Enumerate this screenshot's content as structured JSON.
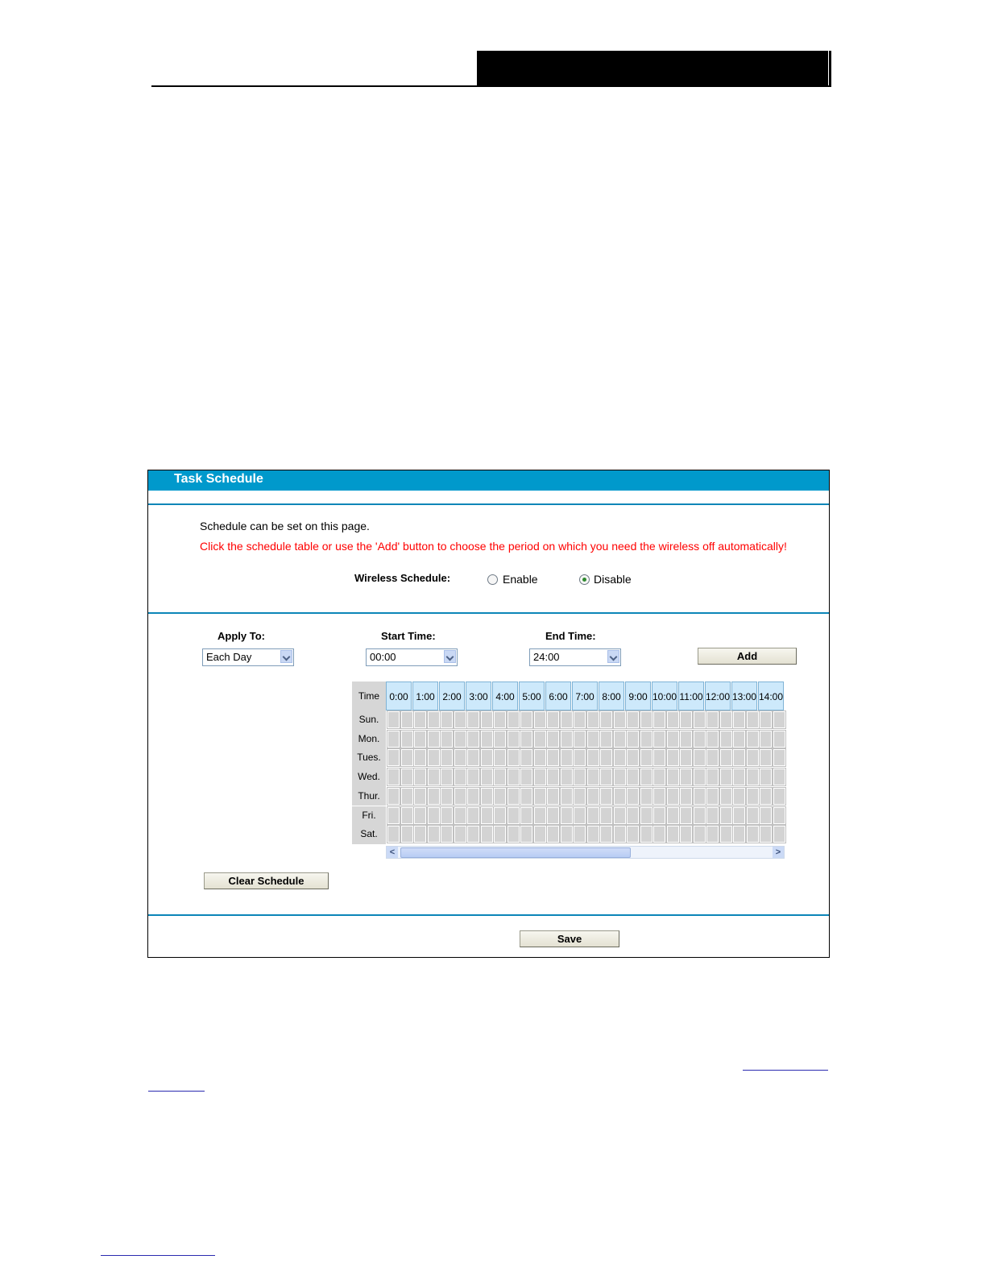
{
  "panel": {
    "title": "Task Schedule",
    "intro": "Schedule can be set on this page.",
    "warning": "Click the schedule table or use the 'Add' button to choose the period on which you need the wireless off automatically!",
    "wireless_schedule": {
      "label": "Wireless Schedule:",
      "enable_label": "Enable",
      "disable_label": "Disable",
      "selected": "Disable"
    }
  },
  "form": {
    "apply_to_label": "Apply To:",
    "apply_to_value": "Each Day",
    "start_time_label": "Start Time:",
    "start_time_value": "00:00",
    "end_time_label": "End Time:",
    "end_time_value": "24:00",
    "add_label": "Add"
  },
  "schedule_table": {
    "time_label": "Time",
    "hours": [
      "0:00",
      "1:00",
      "2:00",
      "3:00",
      "4:00",
      "5:00",
      "6:00",
      "7:00",
      "8:00",
      "9:00",
      "10:00",
      "11:00",
      "12:00",
      "13:00",
      "14:00"
    ],
    "days": [
      "Sun.",
      "Mon.",
      "Tues.",
      "Wed.",
      "Thur.",
      "Fri.",
      "Sat."
    ]
  },
  "clear_schedule_label": "Clear Schedule",
  "save_label": "Save"
}
